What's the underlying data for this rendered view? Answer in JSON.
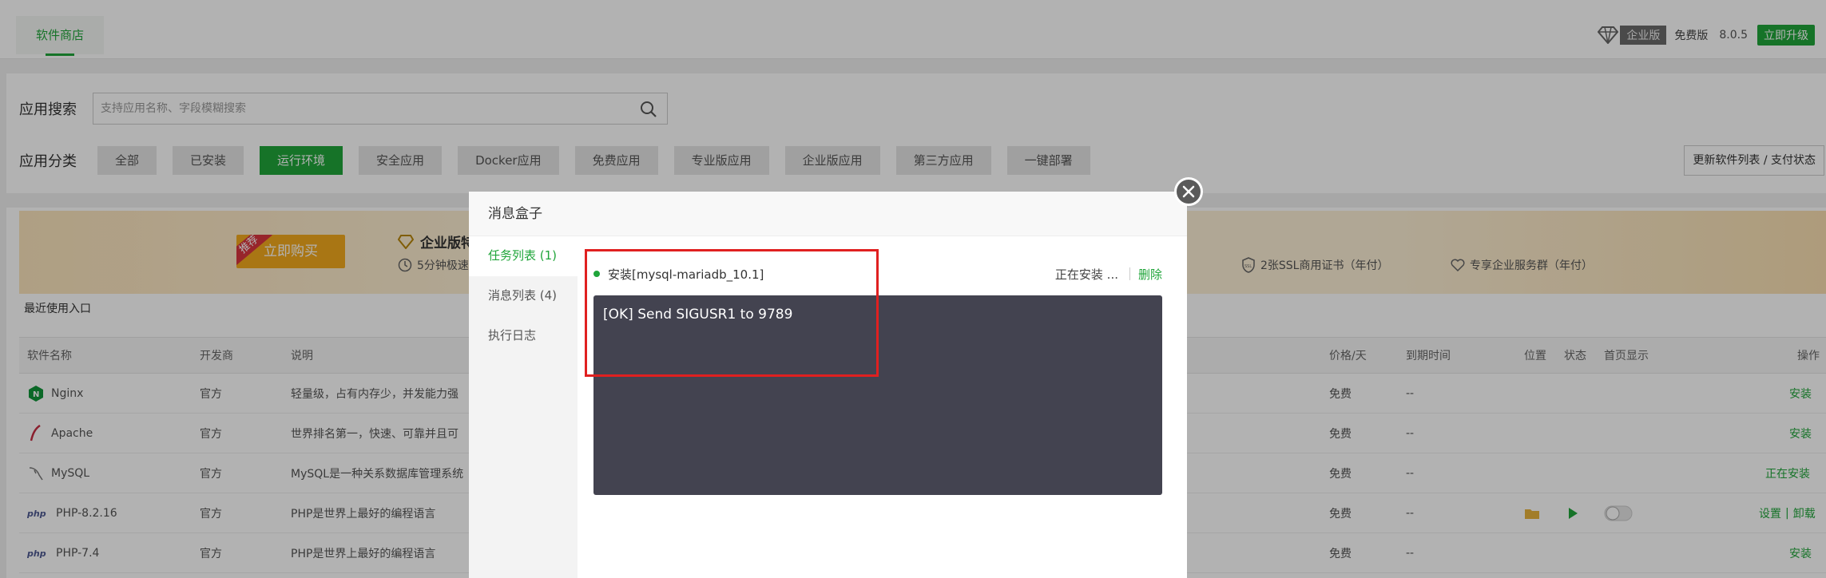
{
  "header": {
    "tab_label": "软件商店",
    "edition_badge": "企业版",
    "free_label": "免费版",
    "version": "8.0.5",
    "upgrade_label": "立即升级"
  },
  "search": {
    "label": "应用搜索",
    "placeholder": "支持应用名称、字段模糊搜索"
  },
  "categories": {
    "label": "应用分类",
    "items": [
      "全部",
      "已安装",
      "运行环境",
      "安全应用",
      "Docker应用",
      "免费应用",
      "专业版应用",
      "企业版应用",
      "第三方应用",
      "一键部署"
    ],
    "active": "运行环境",
    "refresh_label": "更新软件列表 / 支付状态"
  },
  "banner": {
    "tag": "推荐",
    "buy_label": "立即购买",
    "title": "企业版特",
    "feature1": "5分钟极速",
    "feature_ssl": "2张SSL商用证书（年付）",
    "feature_service": "专享企业服务群（年付）"
  },
  "recent_label": "最近使用入口",
  "table": {
    "headers": {
      "name": "软件名称",
      "dev": "开发商",
      "desc": "说明",
      "price": "价格/天",
      "expire": "到期时间",
      "position": "位置",
      "status": "状态",
      "home": "首页显示",
      "action": "操作"
    },
    "rows": [
      {
        "name": "Nginx",
        "dev": "官方",
        "desc": "轻量级，占有内存少，并发能力强",
        "price": "免费",
        "expire": "--",
        "action": "安装"
      },
      {
        "name": "Apache",
        "dev": "官方",
        "desc": "世界排名第一，快速、可靠并且可",
        "price": "免费",
        "expire": "--",
        "action": "安装"
      },
      {
        "name": "MySQL",
        "dev": "官方",
        "desc": "MySQL是一种关系数据库管理系统",
        "price": "免费",
        "expire": "--",
        "action": "正在安装"
      },
      {
        "name": "PHP-8.2.16",
        "dev": "官方",
        "desc": "PHP是世界上最好的编程语言",
        "price": "免费",
        "expire": "--",
        "action_set": "设置",
        "action_sep": "|",
        "action_uninstall": "卸载"
      },
      {
        "name": "PHP-7.4",
        "dev": "官方",
        "desc": "PHP是世界上最好的编程语言",
        "price": "免费",
        "expire": "--",
        "action": "安装"
      }
    ]
  },
  "modal": {
    "title": "消息盒子",
    "tabs": [
      "任务列表 (1)",
      "消息列表 (4)",
      "执行日志"
    ],
    "task_name": "安装[mysql-mariadb_10.1]",
    "task_status": "正在安装 ...",
    "delete_label": "删除",
    "console_text": "[OK] Send SIGUSR1 to 9789"
  },
  "colors": {
    "accent": "#20a53a",
    "console_bg": "#434350",
    "highlight": "#e02020"
  }
}
